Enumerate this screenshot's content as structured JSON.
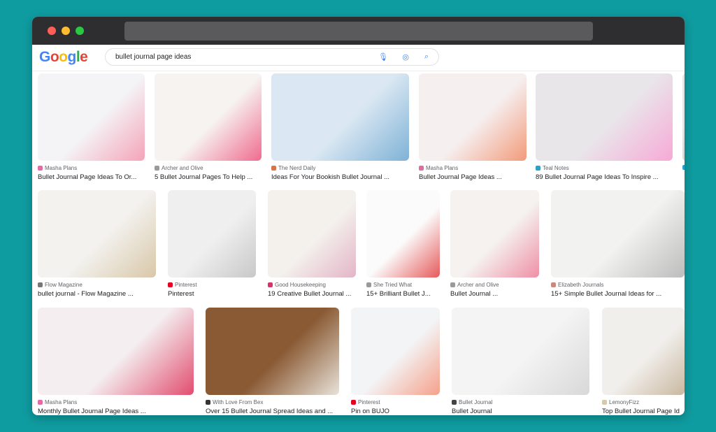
{
  "search": {
    "query": "bullet journal page ideas",
    "logo": "Google"
  },
  "colors": {
    "titlebar": "#2e2e30",
    "close": "#ff5f57",
    "minimize": "#febc2e",
    "maximize": "#28c840",
    "background": "#0f9ca0"
  },
  "rows": [
    [
      {
        "source": "Masha Plans",
        "title": "Bullet Journal Page Ideas To Or...",
        "icon": "#e46aa6",
        "colors": [
          "#f4f4f6",
          "#f5a3b8"
        ]
      },
      {
        "source": "Archer and Olive",
        "title": "5 Bullet Journal Pages To Help ...",
        "icon": "#9a9a9a",
        "colors": [
          "#f6f3f1",
          "#f06b8f"
        ]
      },
      {
        "source": "The Nerd Daily",
        "title": "Ideas For Your Bookish Bullet Journal ...",
        "icon": "#d9744a",
        "colors": [
          "#dbe8f3",
          "#7fb2d6"
        ]
      },
      {
        "source": "Masha Plans",
        "title": "Bullet Journal Page Ideas ...",
        "icon": "#e46aa6",
        "colors": [
          "#f6eff0",
          "#f29b7a"
        ]
      },
      {
        "source": "Teal Notes",
        "title": "89 Bullet Journal Page Ideas To Inspire ...",
        "icon": "#2aa1c9",
        "colors": [
          "#e9e6ea",
          "#f7a9d6"
        ]
      },
      {
        "source": "",
        "title": "",
        "icon": "#2aa1c9",
        "colors": [
          "#e6e6e6",
          "#d6d6d6"
        ]
      }
    ],
    [
      {
        "source": "Flow Magazine",
        "title": "bullet journal - Flow Magazine ...",
        "icon": "#777777",
        "colors": [
          "#f3f2ef",
          "#d9c7a8"
        ]
      },
      {
        "source": "Pinterest",
        "title": "Pinterest",
        "icon": "#e60023",
        "colors": [
          "#efefef",
          "#c8c8c8"
        ]
      },
      {
        "source": "Good Housekeeping",
        "title": "19 Creative Bullet Journal ...",
        "icon": "#d6336c",
        "colors": [
          "#f4f1ed",
          "#e3b5c7"
        ]
      },
      {
        "source": "She Tried What",
        "title": "15+ Brilliant Bullet J...",
        "icon": "#9a9a9a",
        "colors": [
          "#fbfbfb",
          "#e65a5a"
        ]
      },
      {
        "source": "Archer and Olive",
        "title": "Bullet Journal ...",
        "icon": "#9a9a9a",
        "colors": [
          "#f5f2ef",
          "#ef8fa5"
        ]
      },
      {
        "source": "Elizabeth Journals",
        "title": "15+ Simple Bullet Journal Ideas for ...",
        "icon": "#c88a7a",
        "colors": [
          "#f2f2f0",
          "#bdbdbd"
        ]
      }
    ],
    [
      {
        "source": "Masha Plans",
        "title": "Monthly Bullet Journal Page Ideas ...",
        "icon": "#e46aa6",
        "colors": [
          "#f4eef0",
          "#e24d6e"
        ]
      },
      {
        "source": "With Love From Bex",
        "title": "Over 15 Bullet Journal Spread Ideas and ...",
        "icon": "#333333",
        "colors": [
          "#8a5a34",
          "#e8e3da"
        ]
      },
      {
        "source": "Pinterest",
        "title": "Pin on BUJO",
        "icon": "#e60023",
        "colors": [
          "#f3f4f5",
          "#f6a08a"
        ]
      },
      {
        "source": "Bullet Journal",
        "title": "Bullet Journal",
        "icon": "#444444",
        "colors": [
          "#f4f4f4",
          "#d8d8d8"
        ]
      },
      {
        "source": "LemonyFizz",
        "title": "Top Bullet Journal Page Id",
        "icon": "#d8c9a8",
        "colors": [
          "#f1efec",
          "#c9b8a0"
        ]
      }
    ]
  ]
}
